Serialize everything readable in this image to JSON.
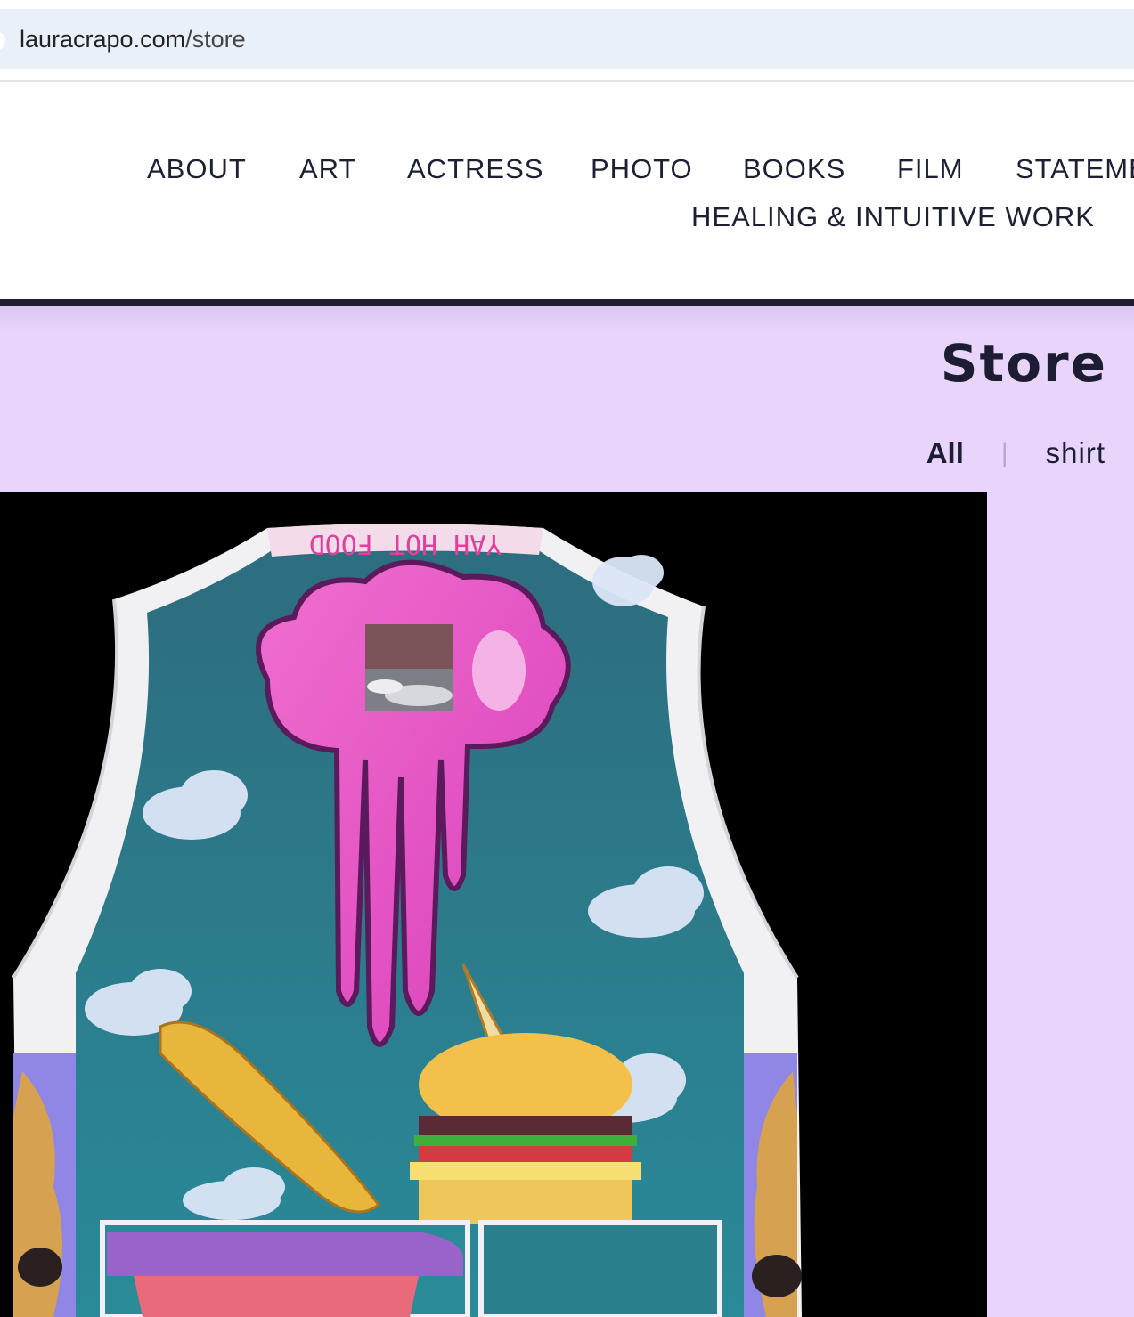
{
  "browser": {
    "url_domain": "lauracrapo.com",
    "url_path": "/store"
  },
  "nav": {
    "items": [
      "ABOUT",
      "ART",
      "ACTRESS",
      "PHOTO",
      "BOOKS",
      "FILM",
      "STATEMENT",
      "HEALING & INTUITIVE WORK"
    ]
  },
  "page": {
    "title": "Store"
  },
  "filters": {
    "all": "All",
    "separator": "|",
    "shirt": "shirt"
  },
  "product": {
    "image_icon": "tank-top-artwork-image",
    "collar_text": "YAH HOT FOOD"
  },
  "colors": {
    "nav_text": "#1d2033",
    "store_bg": "#e9d5fb",
    "divider": "#1c1d33",
    "product_bg": "#000000"
  }
}
